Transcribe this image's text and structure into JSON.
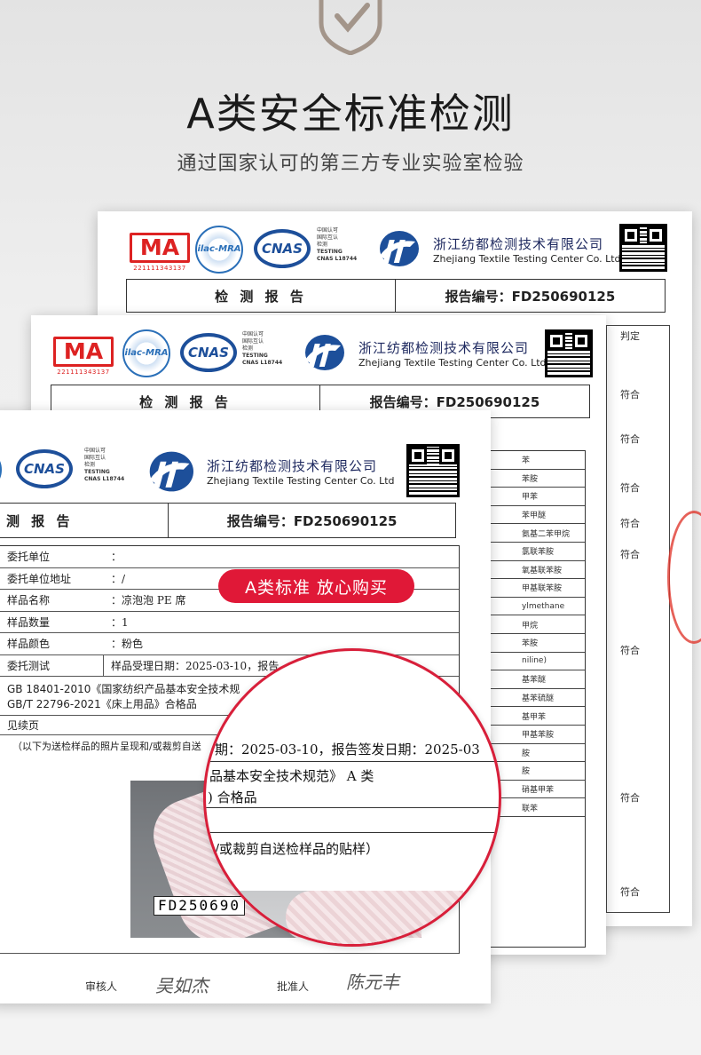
{
  "header": {
    "title": "A类安全标准检测",
    "subtitle": "通过国家认可的第三方专业实验室检验"
  },
  "certs": {
    "ma_text": "MA",
    "ma_number": "221111343137",
    "ilac_text": "ilac-MRA",
    "cnas_text": "CNAS",
    "cnas_desc": [
      "中国认可",
      "国际互认",
      "检测",
      "TESTING",
      "CNAS L18744"
    ]
  },
  "company": {
    "name_zh": "浙江纺都检测技术有限公司",
    "name_en": "Zhejiang Textile Testing Center Co. Ltd"
  },
  "report": {
    "title": "检 测 报 告",
    "number": "报告编号：FD250690125",
    "title_partial": "测 报 告",
    "fields": [
      {
        "k": "委托单位",
        "v": "："
      },
      {
        "k": "委托单位地址",
        "v": "：/"
      },
      {
        "k": "样品名称",
        "v": "：凉泡泡 PE 席"
      },
      {
        "k": "样品数量",
        "v": "：1"
      },
      {
        "k": "样品颜色",
        "v": "：粉色"
      },
      {
        "k": "委托测试",
        "v": "样品受理日期：2025-03-10，报告"
      }
    ],
    "standard_1": "GB 18401-2010《国家纺织产品基本安全技术规",
    "standard_2": "GB/T 22796-2021《床上用品》合格品",
    "continued": "见续页",
    "photo_note": "（以下为送检样品的照片呈现和/或裁剪自送",
    "sample_label": "FD250690",
    "reviewer_label": "审核人",
    "approver_label": "批准人",
    "reviewer_sig": "吴如杰",
    "approver_sig": "陈元丰"
  },
  "badge": "A类标准 放心购买",
  "magnifier": {
    "line1": "期：2025-03-10，报告签发日期：2025-03",
    "line2": "品基本安全技术规范》 A 类",
    "line3": ") 合格品",
    "line4": "/或裁剪自送检样品的贴样）"
  },
  "back_sheet": {
    "judge_header": "判定",
    "judgments": [
      "符合",
      "符合",
      "符合",
      "符合",
      "符合",
      "符合",
      "符合",
      "符合"
    ],
    "items": [
      "苯",
      "苯胺",
      "甲苯",
      "苯甲醚",
      "氨基二苯甲烷",
      "氯联苯胺",
      "氧基联苯胺",
      "甲基联苯胺",
      "ylmethane",
      "甲烷",
      "苯胺",
      "niline)",
      "基苯醚",
      "基苯硫醚",
      "基甲苯",
      "甲基苯胺",
      "胺",
      "胺",
      "硝基甲苯",
      "联苯"
    ]
  }
}
